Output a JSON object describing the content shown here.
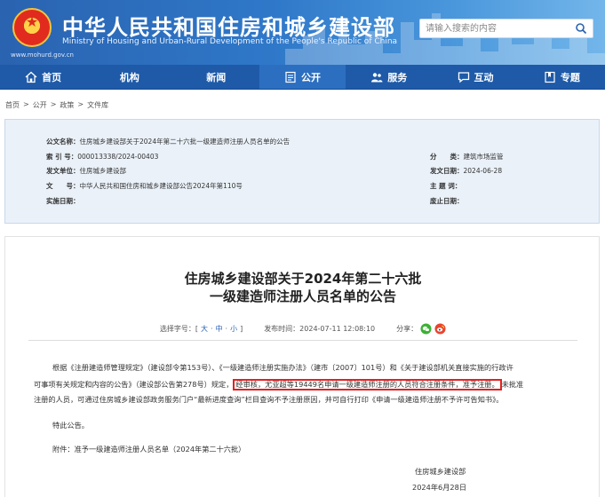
{
  "header": {
    "title": "中华人民共和国住房和城乡建设部",
    "subtitle": "Ministry of Housing and Urban-Rural Development of the People's Republic of China",
    "url": "www.mohurd.gov.cn",
    "search_placeholder": "请输入搜索的内容"
  },
  "nav": [
    {
      "label": "首页",
      "icon": "home-icon"
    },
    {
      "label": "机构",
      "icon": ""
    },
    {
      "label": "新闻",
      "icon": ""
    },
    {
      "label": "公开",
      "icon": "document-icon"
    },
    {
      "label": "服务",
      "icon": "people-icon"
    },
    {
      "label": "互动",
      "icon": "chat-icon"
    },
    {
      "label": "专题",
      "icon": "bookmark-icon"
    }
  ],
  "breadcrumb": [
    "首页",
    "公开",
    "政策",
    "文件库"
  ],
  "meta": {
    "title_label": "公文名称：",
    "title_value": "住房城乡建设部关于2024年第二十六批一级建造师注册人员名单的公告",
    "index_label": "索 引 号：",
    "index_value": "000013338/2024-00403",
    "category_label": "分　　类：",
    "category_value": "建筑市场监管",
    "issuer_label": "发文单位：",
    "issuer_value": "住房城乡建设部",
    "date_label": "发文日期：",
    "date_value": "2024-06-28",
    "docno_label": "文　　号：",
    "docno_value": "中华人民共和国住房和城乡建设部公告2024年第110号",
    "subject_label": "主 题 词：",
    "subject_value": "",
    "effective_label": "实施日期：",
    "effective_value": "",
    "expire_label": "废止日期：",
    "expire_value": ""
  },
  "article": {
    "title_line1": "住房城乡建设部关于2024年第二十六批",
    "title_line2": "一级建造师注册人员名单的公告",
    "font_label": "选择字号：[",
    "font_large": "大",
    "font_medium": "中",
    "font_small": "小",
    "font_close": "]",
    "publish_label": "发布时间：2024-07-11 12:08:10",
    "share_label": "分享：",
    "p1_line1": "根据《注册建造师管理规定》（建设部令第153号）、《一级建造师注册实施办法》（建市〔2007〕101号）和《关于建设部机关直接实施的行政许",
    "p1_line2_a": "可事项有关规定和内容的公告》（建设部公告第278号）规定，",
    "p1_line2_hl": "经审核，尤亚超等19449名申请一级建造师注册的人员符合注册条件，准予注册。",
    "p1_line2_b": "未批准",
    "p1_line3": "注册的人员，可通过住房城乡建设部政务服务门户“最新进度查询”栏目查询不予注册原因，并可自行打印《申请一级建造师注册不予许可告知书》。",
    "p2": "特此公告。",
    "attachment": "附件：准予一级建造师注册人员名单（2024年第二十六批）",
    "signature": "住房城乡建设部",
    "sign_date": "2024年6月28日"
  },
  "colors": {
    "header_start": "#2a63b0",
    "nav_bg": "#1e5aa8",
    "meta_bg": "#eaf1f9",
    "highlight_border": "#e22020"
  }
}
